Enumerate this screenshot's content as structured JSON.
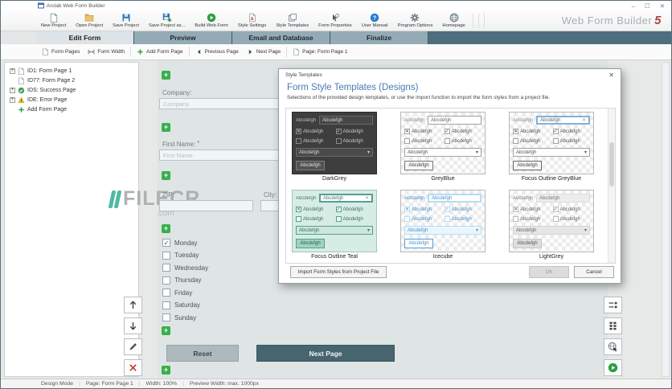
{
  "window": {
    "title": "Arclab Web Form Builder",
    "brand": "Web Form Builder",
    "version": "5",
    "minimize": "–",
    "maximize": "☐",
    "close": "✕"
  },
  "toolbar": {
    "buttons": [
      {
        "label": "New Project",
        "icon": "new-project"
      },
      {
        "label": "Open Project",
        "icon": "open-project"
      },
      {
        "label": "Save Project",
        "icon": "save-project"
      },
      {
        "label": "Save Project as...",
        "icon": "save-project-as"
      },
      {
        "label": "Build Web Form",
        "icon": "build-web-form",
        "sep_before": true
      },
      {
        "label": "Style Settings",
        "icon": "style-settings",
        "sep_before": true
      },
      {
        "label": "Style Templates",
        "icon": "style-templates"
      },
      {
        "label": "Form Properties",
        "icon": "form-properties"
      },
      {
        "label": "User Manual",
        "icon": "user-manual",
        "sep_before": true
      },
      {
        "label": "Program Options",
        "icon": "program-options"
      },
      {
        "label": "Homepage",
        "icon": "homepage"
      }
    ]
  },
  "tabs": [
    {
      "label": "Edit Form",
      "active": true
    },
    {
      "label": "Preview",
      "active": false
    },
    {
      "label": "Email and Database",
      "active": false
    },
    {
      "label": "Finalize",
      "active": false
    }
  ],
  "page_toolbar": [
    {
      "label": "Form Pages",
      "icon": "doc"
    },
    {
      "label": "Form Width",
      "icon": "width",
      "sep_after": true
    },
    {
      "label": "Add Form Page",
      "icon": "plus-green",
      "sep_after": true
    },
    {
      "label": "Previous Page",
      "icon": "prev"
    },
    {
      "label": "Next Page",
      "icon": "next",
      "sep_after": true
    },
    {
      "label": "Page: Form Page 1",
      "icon": "doc"
    }
  ],
  "tree": [
    {
      "label": "ID1: Form Page 1",
      "icon": "doc",
      "expand": true
    },
    {
      "label": "ID77: Form Page 2",
      "icon": "doc",
      "expand": false
    },
    {
      "label": "IDS: Success Page",
      "icon": "success",
      "expand": true
    },
    {
      "label": "IDE: Error Page",
      "icon": "warning",
      "expand": true
    },
    {
      "label": "Add Form Page",
      "icon": "add",
      "expand": false
    }
  ],
  "canvas": {
    "company_label": "Company:",
    "company_placeholder": "Company",
    "first_name_label": "First Name:",
    "required_mark": "*",
    "first_name_placeholder": "First Name",
    "zip_label": "ZIP:",
    "city_label": "City:",
    "days": [
      {
        "label": "Monday",
        "checked": true
      },
      {
        "label": "Tuesday",
        "checked": false
      },
      {
        "label": "Wednesday",
        "checked": false
      },
      {
        "label": "Thursday",
        "checked": false
      },
      {
        "label": "Friday",
        "checked": false
      },
      {
        "label": "Saturday",
        "checked": false
      },
      {
        "label": "Sunday",
        "checked": false
      }
    ],
    "reset_button": "Reset",
    "next_button": "Next Page"
  },
  "watermark": {
    "text": "FILECR",
    "suffix": ".com"
  },
  "dialog": {
    "title": "Style Templates",
    "close": "✕",
    "heading": "Form Style Templates (Designs)",
    "subtitle": "Selections of the provided design templates, or use the import function to import the form styles from a project file.",
    "sample_text": "Abcdefgh",
    "templates": [
      {
        "name": "DarkGrey",
        "theme": "darkgrey",
        "focus": false
      },
      {
        "name": "GreyBlue",
        "theme": "greyblue",
        "focus": false
      },
      {
        "name": "Focus Outline GreyBlue",
        "theme": "focus-greyblue",
        "focus": true
      },
      {
        "name": "Focus Outline Teal",
        "theme": "focus-teal",
        "focus": true
      },
      {
        "name": "Icecube",
        "theme": "icecube",
        "focus": false
      },
      {
        "name": "LightGrey",
        "theme": "lightgrey",
        "focus": false
      }
    ],
    "import_button": "Import Form Styles from Project File",
    "ok_button": "OK",
    "cancel_button": "Cancel"
  },
  "statusbar": [
    "Design Mode",
    "Page: Form Page 1",
    "Width: 100%",
    "Preview Width: max. 1000px"
  ],
  "icons": {
    "plus": "+",
    "check": "✓",
    "cross": "✕",
    "chevron_down": "▾"
  },
  "colors": {
    "accent_green": "#3aaf4c",
    "brand_red": "#a94442",
    "heading_blue": "#4a7ab5",
    "tab_strip": "#4f6e7d",
    "next_button": "#47656f",
    "watermark_teal": "#3ab29b"
  }
}
